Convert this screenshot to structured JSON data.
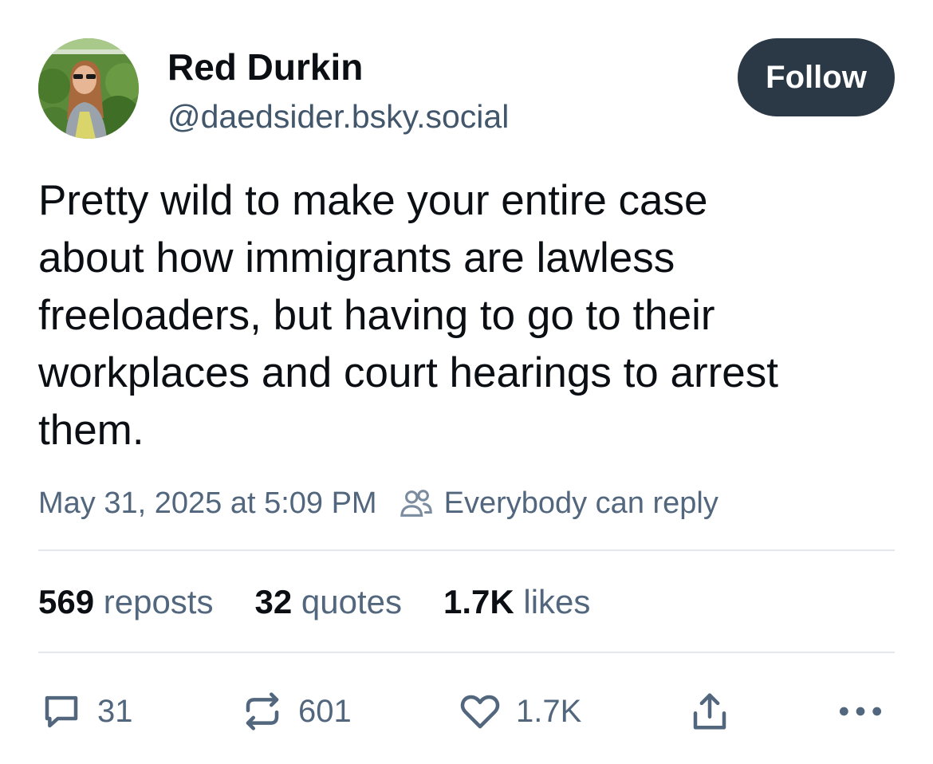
{
  "author": {
    "display_name": "Red Durkin",
    "handle": "@daedsider.bsky.social",
    "avatar_icon": "user-avatar-photo"
  },
  "follow_label": "Follow",
  "post": {
    "text": "Pretty wild to make your entire case\nabout how immigrants are lawless\nfreeloaders, but having to go to their\nworkplaces and court hearings to arrest\nthem."
  },
  "meta": {
    "timestamp": "May 31, 2025 at 5:09 PM",
    "reply_setting": "Everybody can reply",
    "reply_setting_icon": "people-icon"
  },
  "stats": {
    "reposts": {
      "count": "569",
      "label": "reposts"
    },
    "quotes": {
      "count": "32",
      "label": "quotes"
    },
    "likes": {
      "count": "1.7K",
      "label": "likes"
    }
  },
  "actions": {
    "reply": {
      "icon": "reply-bubble-icon",
      "count": "31"
    },
    "repost": {
      "icon": "repost-icon",
      "count": "601"
    },
    "like": {
      "icon": "heart-icon",
      "count": "1.7K"
    },
    "share": {
      "icon": "share-icon"
    },
    "more": {
      "icon": "more-dots-icon"
    }
  },
  "colors": {
    "text": "#0b0f14",
    "secondary": "#52677d",
    "follow_bg": "#2b3845",
    "divider": "#e3e8ee"
  }
}
